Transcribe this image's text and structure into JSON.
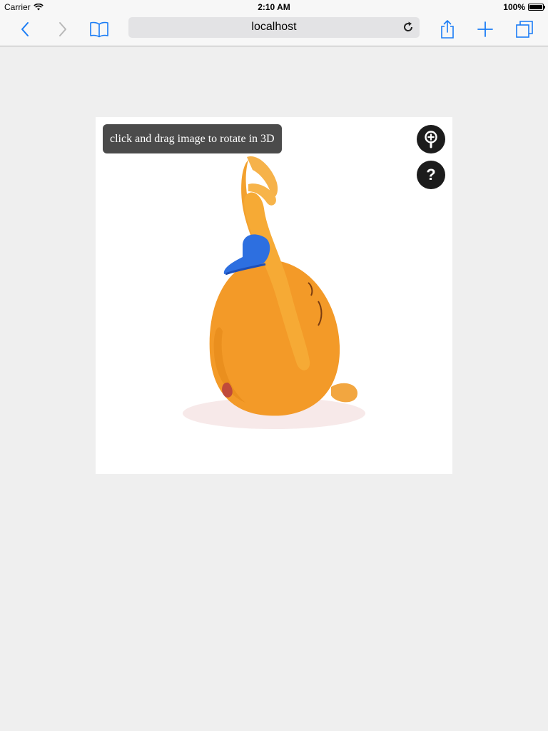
{
  "status": {
    "carrier": "Carrier",
    "time": "2:10 AM",
    "battery": "100%"
  },
  "toolbar": {
    "address": "localhost"
  },
  "viewer": {
    "hint": "click and drag image to rotate in 3D",
    "help_label": "?",
    "product_icon": "orange-plush-toy-image"
  },
  "colors": {
    "ios_blue": "#1a7cf5",
    "toolbar_bg": "#f7f7f7",
    "page_bg": "#efefef",
    "hint_bg": "#4b4b4b",
    "button_bg": "#1c1c1c"
  }
}
